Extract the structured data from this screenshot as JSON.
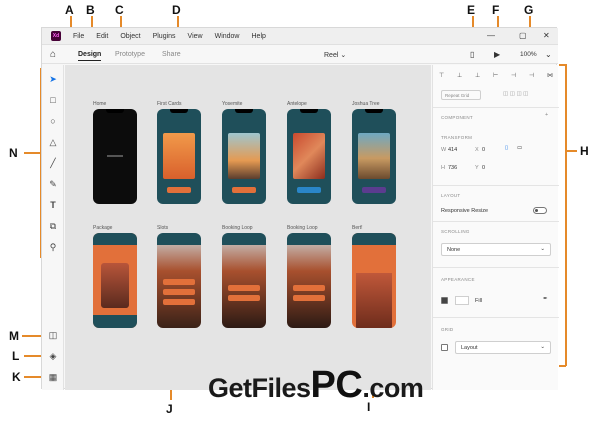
{
  "callouts": {
    "A": "A",
    "B": "B",
    "C": "C",
    "D": "D",
    "E": "E",
    "F": "F",
    "G": "G",
    "H": "H",
    "I": "I",
    "J": "J",
    "K": "K",
    "L": "L",
    "M": "M",
    "N": "N"
  },
  "app": {
    "logo": "Xd",
    "menu": [
      "File",
      "Edit",
      "Object",
      "Plugins",
      "View",
      "Window",
      "Help"
    ],
    "tabs": [
      "Design",
      "Prototype",
      "Share"
    ],
    "document_name": "Reel",
    "zoom": "100%"
  },
  "tools": [
    "select-tool",
    "rectangle-tool",
    "ellipse-tool",
    "polygon-tool",
    "line-tool",
    "pen-tool",
    "text-tool",
    "artboard-tool",
    "zoom-tool"
  ],
  "bottom_tools": [
    "plugins-icon",
    "layers-icon",
    "assets-icon"
  ],
  "artboards_row1": [
    {
      "label": "Home",
      "style": "black"
    },
    {
      "label": "First Cards",
      "style": "teal-orange"
    },
    {
      "label": "Yosemite",
      "style": "teal-sunset"
    },
    {
      "label": "Antelope",
      "style": "teal-canyon"
    },
    {
      "label": "Joshua Tree",
      "style": "teal-purple"
    }
  ],
  "artboards_row2": [
    {
      "label": "Package",
      "style": "orange"
    },
    {
      "label": "Slots",
      "style": "rock"
    },
    {
      "label": "Booking Loop",
      "style": "rock"
    },
    {
      "label": "Booking Loop",
      "style": "rock"
    },
    {
      "label": "Bert!",
      "style": "orange-rock"
    }
  ],
  "panel": {
    "repeat_grid": "Repeat Grid",
    "component": "COMPONENT",
    "transform": "TRANSFORM",
    "w_label": "W",
    "w_value": "414",
    "x_label": "X",
    "x_value": "0",
    "h_label": "H",
    "h_value": "736",
    "y_label": "Y",
    "y_value": "0",
    "layout": "LAYOUT",
    "responsive_resize": "Responsive Resize",
    "scrolling": "SCROLLING",
    "scrolling_value": "None",
    "appearance": "APPEARANCE",
    "fill": "Fill",
    "grid": "GRID",
    "grid_value": "Layout"
  },
  "watermark": {
    "part1": "GetFiles",
    "part2": "PC",
    "part3": ".com"
  },
  "colors": {
    "accent": "#e58a2a",
    "teal": "#1f4f5a",
    "orange": "#e2703a",
    "purple": "#5b3c8f"
  }
}
